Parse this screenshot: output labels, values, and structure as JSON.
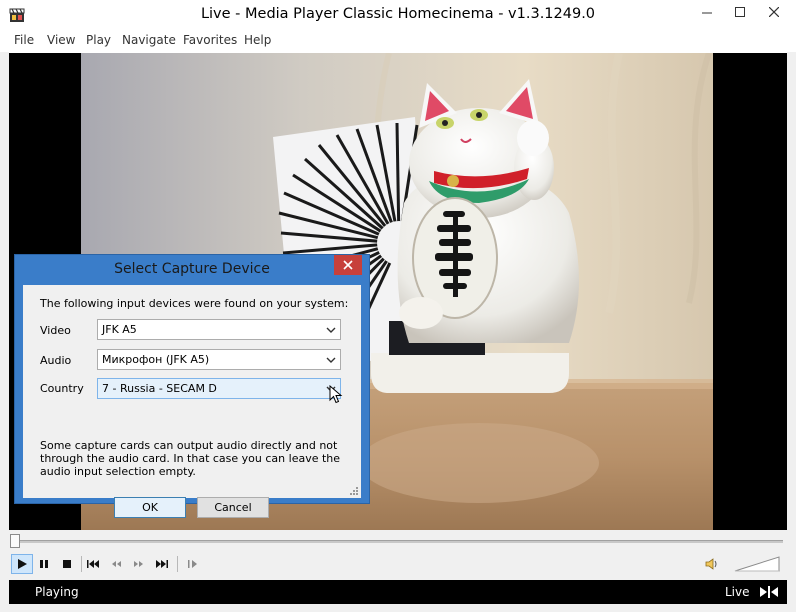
{
  "window": {
    "title": "Live - Media Player Classic Homecinema - v1.3.1249.0",
    "icons": {
      "app": "film-clapper-icon",
      "minimize": "minimize-icon",
      "maximize": "maximize-icon",
      "close": "close-icon"
    }
  },
  "menu": {
    "items": [
      {
        "label": "File"
      },
      {
        "label": "View"
      },
      {
        "label": "Play"
      },
      {
        "label": "Navigate"
      },
      {
        "label": "Favorites"
      },
      {
        "label": "Help"
      }
    ]
  },
  "controls": {
    "buttons": [
      "play-icon",
      "pause-icon",
      "stop-icon",
      "skip-back-icon",
      "rewind-icon",
      "fast-forward-icon",
      "skip-forward-icon",
      "frame-step-icon"
    ],
    "volume_icon": "speaker-icon",
    "seek_position": 0
  },
  "status": {
    "state": "Playing",
    "time": "Live"
  },
  "dialog": {
    "title": "Select Capture Device",
    "intro": "The following input devices were found on your system:",
    "video_label": "Video",
    "video_value": "JFK A5",
    "audio_label": "Audio",
    "audio_value": "Микрофон (JFK A5)",
    "country_label": "Country",
    "country_value": "7 - Russia - SECAM D",
    "note": "Some capture cards can output audio directly and not through the audio card. In that case you can leave the audio input selection empty.",
    "ok_label": "OK",
    "cancel_label": "Cancel"
  },
  "colors": {
    "dialog_accent": "#3a7dc9",
    "close_red": "#c7403b",
    "status_bg": "#000000"
  }
}
